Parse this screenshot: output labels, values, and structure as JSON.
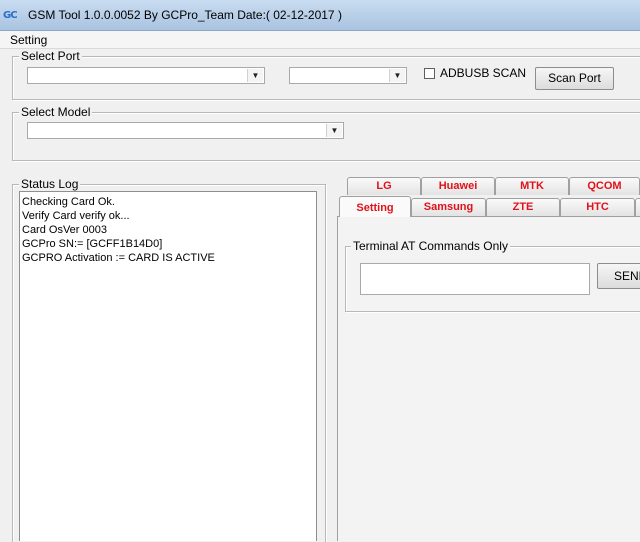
{
  "window": {
    "icon_text": "GC",
    "title": "GSM Tool 1.0.0.0052 By GCPro_Team  Date:( 02-12-2017 )"
  },
  "menu": {
    "setting": "Setting"
  },
  "select_port": {
    "label": "Select Port",
    "port_value": "",
    "speed_value": "",
    "adbusb_label": "ADBUSB SCAN",
    "scan_button": "Scan Port"
  },
  "select_model": {
    "label": "Select Model",
    "value": ""
  },
  "status_log": {
    "label": "Status Log",
    "lines": [
      "Checking Card Ok.",
      "Verify Card verify ok...",
      "Card OsVer 0003",
      "GCPro SN:= [GCFF1B14D0]",
      "GCPRO Activation := CARD IS ACTIVE"
    ]
  },
  "tabs": {
    "row1": [
      "LG",
      "Huawei",
      "MTK",
      "QCOM"
    ],
    "row2": [
      "Setting",
      "Samsung",
      "ZTE",
      "HTC"
    ],
    "active": "Setting"
  },
  "terminal": {
    "label": "Terminal AT Commands Only",
    "input_value": "",
    "send_button": "SEND"
  },
  "colors": {
    "tab_text": "#e0121a",
    "titlebar": "#b6cde6"
  }
}
